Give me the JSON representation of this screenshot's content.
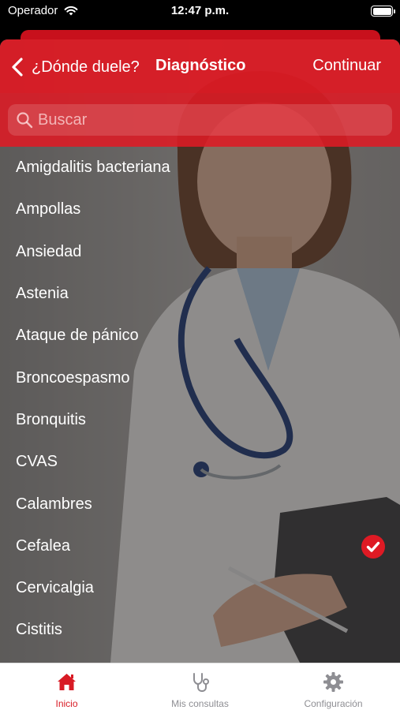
{
  "status_bar": {
    "carrier": "Operador",
    "time": "12:47 p.m."
  },
  "nav": {
    "back_label": "¿Dónde duele?",
    "title": "Diagnóstico",
    "continue_label": "Continuar"
  },
  "search": {
    "placeholder": "Buscar",
    "value": ""
  },
  "list": {
    "items": [
      {
        "label": "Amigdalitis bacteriana",
        "selected": false
      },
      {
        "label": "Ampollas",
        "selected": false
      },
      {
        "label": "Ansiedad",
        "selected": false
      },
      {
        "label": "Astenia",
        "selected": false
      },
      {
        "label": "Ataque de pánico",
        "selected": false
      },
      {
        "label": "Broncoespasmo",
        "selected": false
      },
      {
        "label": "Bronquitis",
        "selected": false
      },
      {
        "label": "CVAS",
        "selected": false
      },
      {
        "label": "Calambres",
        "selected": false
      },
      {
        "label": "Cefalea",
        "selected": true
      },
      {
        "label": "Cervicalgia",
        "selected": false
      },
      {
        "label": "Cistitis",
        "selected": false
      }
    ]
  },
  "tab_bar": {
    "tabs": [
      {
        "label": "Inicio",
        "icon": "home-icon",
        "active": true
      },
      {
        "label": "Mis consultas",
        "icon": "stethoscope-icon",
        "active": false
      },
      {
        "label": "Configuración",
        "icon": "gear-icon",
        "active": false
      }
    ]
  },
  "colors": {
    "brand_red": "#de1a24",
    "active_tab": "#d81b25",
    "inactive_tab": "#8e8e93"
  }
}
